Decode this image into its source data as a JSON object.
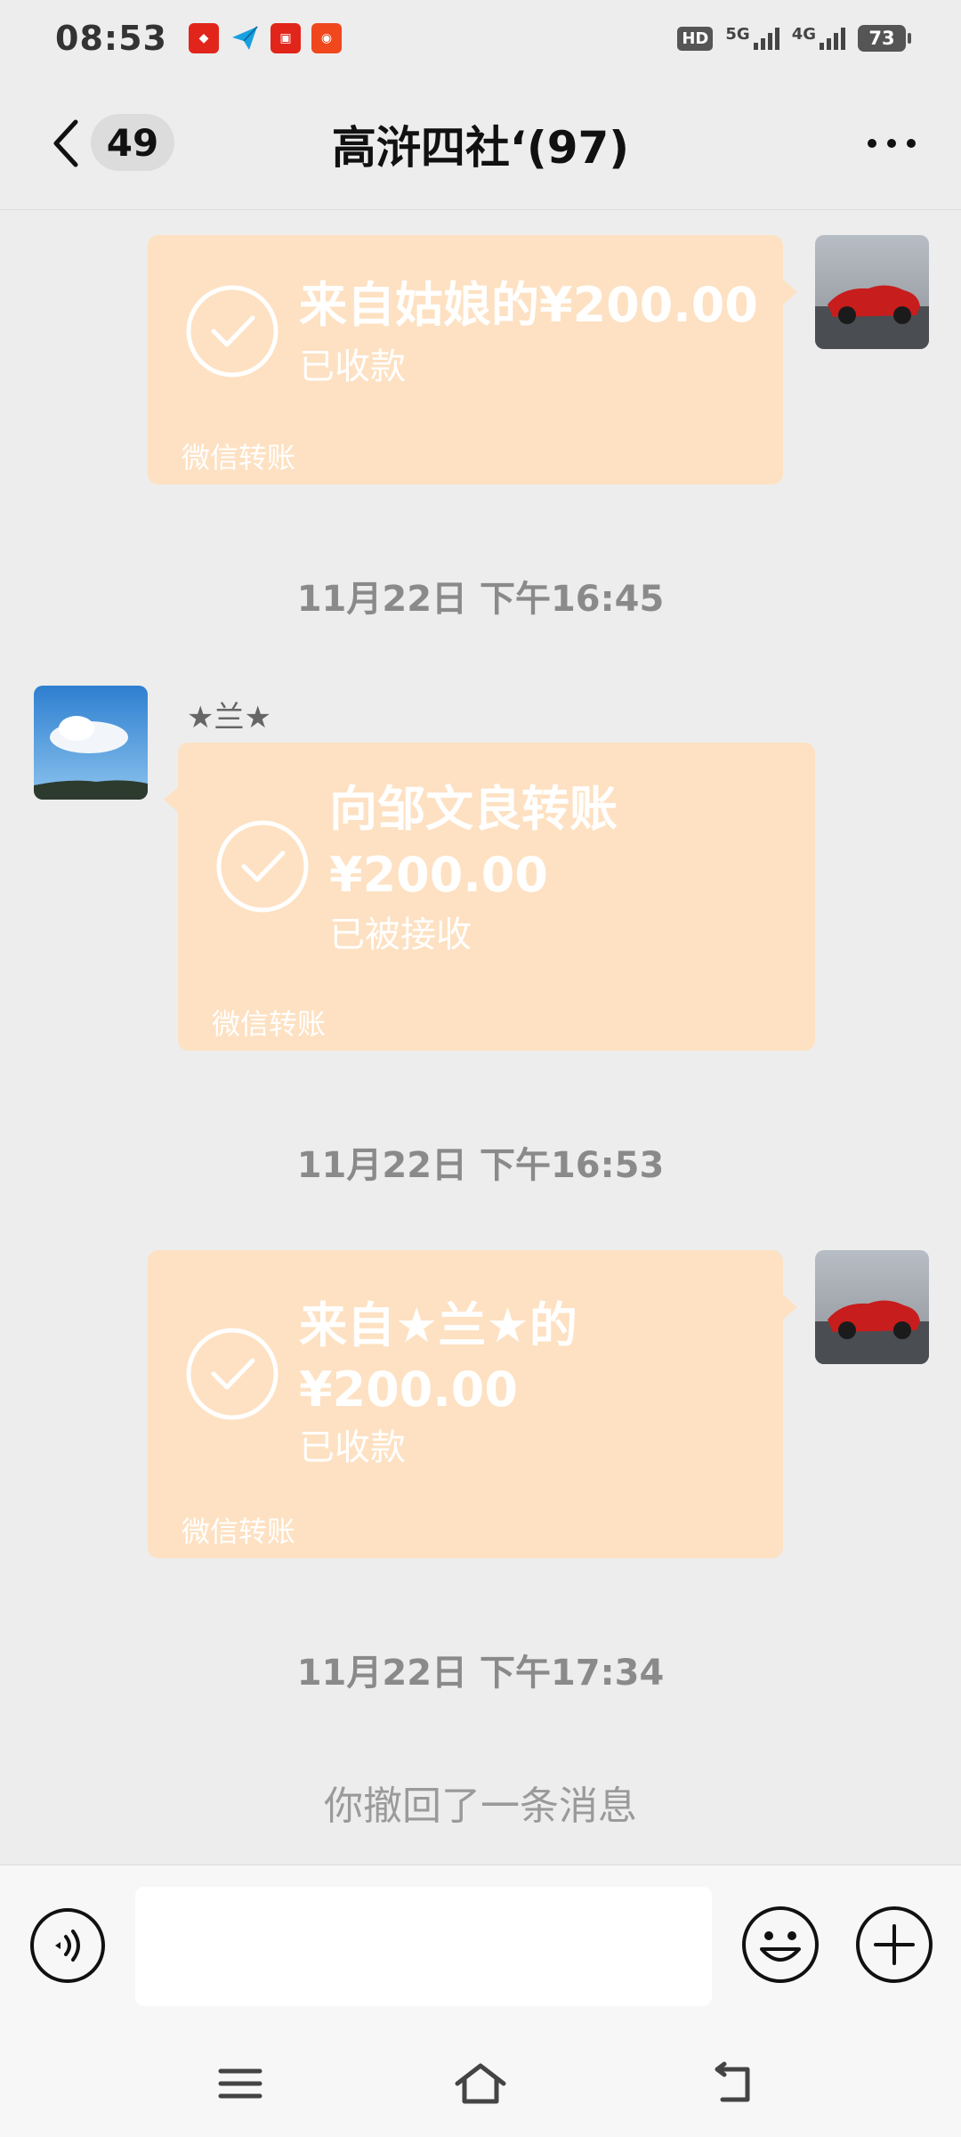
{
  "status_bar": {
    "time": "08:53",
    "hd": "HD",
    "net1": "5G",
    "net2": "4G",
    "battery": "73"
  },
  "nav": {
    "unread_count": "49",
    "title": "高浒四社‘(97)"
  },
  "messages": [
    {
      "type": "transfer",
      "side": "right",
      "line1": "来自姑娘的¥200.00",
      "status": "已收款",
      "footer": "微信转账"
    },
    {
      "type": "time",
      "text": "11月22日 下午16:45"
    },
    {
      "type": "transfer",
      "side": "left",
      "sender": "★兰★",
      "line1": "向邹文良转账",
      "line2": "¥200.00",
      "status": "已被接收",
      "footer": "微信转账"
    },
    {
      "type": "time",
      "text": "11月22日 下午16:53"
    },
    {
      "type": "transfer",
      "side": "right",
      "line1": "来自★兰★的",
      "line2": "¥200.00",
      "status": "已收款",
      "footer": "微信转账"
    },
    {
      "type": "time",
      "text": "11月22日 下午17:34"
    },
    {
      "type": "system",
      "text": "你撤回了一条消息"
    }
  ],
  "input": {
    "value": ""
  },
  "icons": {
    "back": "chevron-left-icon",
    "more": "more-dots-icon",
    "voice": "voice-icon",
    "emoji": "emoji-icon",
    "plus": "plus-icon",
    "check": "check-circle-icon",
    "menu": "menu-icon",
    "home": "home-icon",
    "back_nav": "back-icon"
  },
  "colors": {
    "transfer_bg": "#fde1c2",
    "page_bg": "#ededed"
  }
}
